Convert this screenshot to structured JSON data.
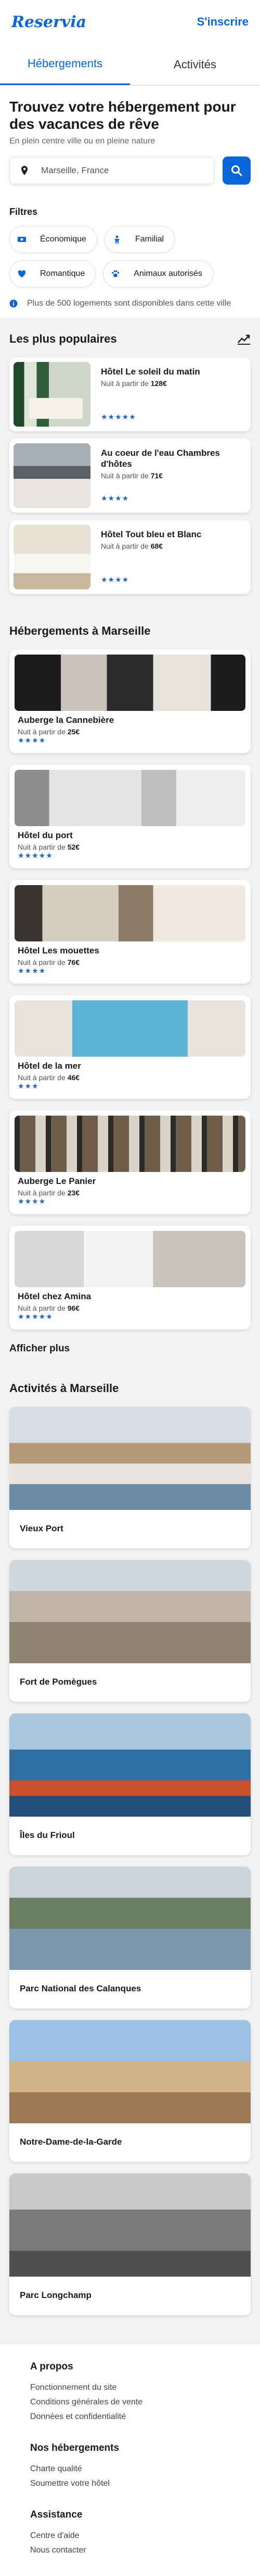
{
  "header": {
    "logo": "Reservia",
    "signup": "S'inscrire"
  },
  "tabs": [
    {
      "label": "Hébergements",
      "active": true
    },
    {
      "label": "Activités",
      "active": false
    }
  ],
  "hero": {
    "title": "Trouvez votre hébergement pour des vacances de rêve",
    "subtitle": "En plein centre ville ou en pleine nature",
    "search_value": "Marseille, France"
  },
  "filters": {
    "title": "Filtres",
    "chips": [
      {
        "label": "Économique",
        "icon": "money-icon"
      },
      {
        "label": "Familial",
        "icon": "child-icon"
      },
      {
        "label": "Romantique",
        "icon": "heart-icon"
      },
      {
        "label": "Animaux autorisés",
        "icon": "paw-icon"
      }
    ],
    "info": "Plus de 500 logements sont disponibles dans cette ville"
  },
  "popular": {
    "title": "Les plus populaires",
    "price_prefix": "Nuit à partir de ",
    "items": [
      {
        "name": "Hôtel Le soleil du matin",
        "price": "128€",
        "stars": "★★★★★"
      },
      {
        "name": "Au coeur de l'eau Chambres d'hôtes",
        "price": "71€",
        "stars": "★★★★"
      },
      {
        "name": "Hôtel Tout bleu et Blanc",
        "price": "68€",
        "stars": "★★★★"
      }
    ]
  },
  "hotels": {
    "title": "Hébergements à Marseille",
    "price_prefix": "Nuit à partir de ",
    "more": "Afficher plus",
    "items": [
      {
        "name": "Auberge la Cannebière",
        "price": "25€",
        "stars": "★★★★"
      },
      {
        "name": "Hôtel du port",
        "price": "52€",
        "stars": "★★★★★"
      },
      {
        "name": "Hôtel Les mouettes",
        "price": "76€",
        "stars": "★★★★"
      },
      {
        "name": "Hôtel de la mer",
        "price": "46€",
        "stars": "★★★"
      },
      {
        "name": "Auberge Le Panier",
        "price": "23€",
        "stars": "★★★★"
      },
      {
        "name": "Hôtel chez Amina",
        "price": "96€",
        "stars": "★★★★★"
      }
    ]
  },
  "activities": {
    "title": "Activités à Marseille",
    "items": [
      {
        "name": "Vieux Port"
      },
      {
        "name": "Fort de Pomègues"
      },
      {
        "name": "Îles du Frioul"
      },
      {
        "name": "Parc National des Calanques"
      },
      {
        "name": "Notre-Dame-de-la-Garde"
      },
      {
        "name": "Parc Longchamp"
      }
    ]
  },
  "footer": {
    "groups": [
      {
        "title": "A propos",
        "links": [
          "Fonctionnement du site",
          "Conditions générales de vente",
          "Données et confidentialité"
        ]
      },
      {
        "title": "Nos hébergements",
        "links": [
          "Charte qualité",
          "Soumettre votre hôtel"
        ]
      },
      {
        "title": "Assistance",
        "links": [
          "Centre d'aide",
          "Nous contacter"
        ]
      }
    ]
  },
  "colors": {
    "accent": "#0a66d8",
    "star": "#2264c4"
  }
}
